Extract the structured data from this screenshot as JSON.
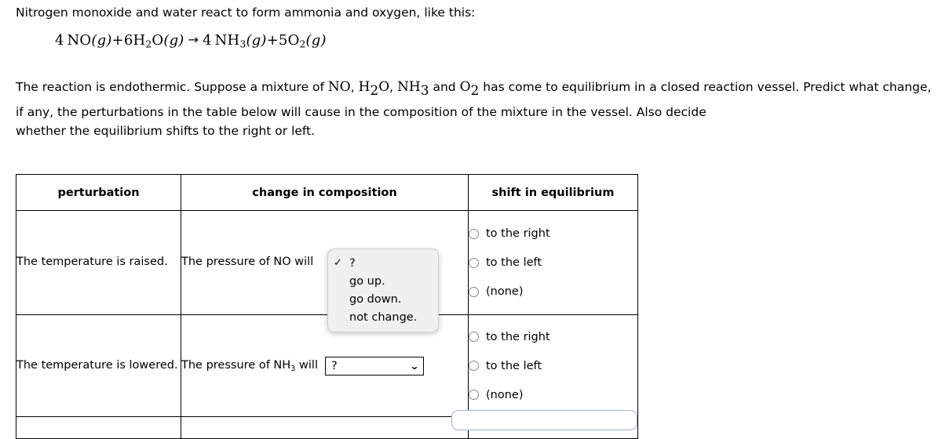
{
  "intro": {
    "sentence": "Nitrogen monoxide and water react to form ammonia and oxygen, like this:"
  },
  "equation": {
    "coeff_no": "4",
    "species_no": "NO",
    "state_no": "(g)",
    "plus1": "+",
    "coeff_h2o": "6",
    "h2o_h": "H",
    "h2o_sub": "2",
    "h2o_o": "O",
    "state_h2o": "(g)",
    "arrow": "→",
    "coeff_nh3": "4",
    "nh3_n": "NH",
    "nh3_sub": "3",
    "state_nh3": "(g)",
    "plus2": "+",
    "coeff_o2": "5",
    "o2_o": "O",
    "o2_sub": "2",
    "state_o2": "(g)"
  },
  "paragraph": {
    "part1": "The reaction is endothermic. Suppose a mixture of ",
    "chem_no": "NO",
    "comma1": ", ",
    "chem_h2o_h": "H",
    "chem_h2o_sub": "2",
    "chem_h2o_o": "O",
    "comma2": ", ",
    "chem_nh3": "NH",
    "chem_nh3_sub": "3",
    "and1": " and ",
    "chem_o2": "O",
    "chem_o2_sub": "2",
    "part2": " has come to equilibrium in a closed reaction vessel. Predict what change, if any, the perturbations in the table below will cause in the composition of the mixture in the vessel. Also decide",
    "line2": "whether the equilibrium shifts to the right or left."
  },
  "table": {
    "headers": {
      "perturbation": "perturbation",
      "change": "change in composition",
      "shift": "shift in equilibrium"
    },
    "rows": [
      {
        "perturbation": "The temperature is raised.",
        "change_label_prefix": "The pressure of ",
        "change_species": "NO",
        "change_species_sub": "",
        "change_label_suffix": " will",
        "select_value": "?",
        "chevron": "⌄",
        "shift_options": [
          "to the right",
          "to the left",
          "(none)"
        ]
      },
      {
        "perturbation": "The temperature is lowered.",
        "change_label_prefix": "The pressure of ",
        "change_species": "NH",
        "change_species_sub": "3",
        "change_label_suffix": " will",
        "select_value": "?",
        "chevron": "⌄",
        "shift_options": [
          "to the right",
          "to the left",
          "(none)"
        ]
      }
    ]
  },
  "dropdown": {
    "checkmark": "✓",
    "options": [
      {
        "label": "?",
        "checked": true
      },
      {
        "label": "go up.",
        "checked": false
      },
      {
        "label": "go down.",
        "checked": false
      },
      {
        "label": "not change.",
        "checked": false
      }
    ]
  },
  "colors": {
    "border": "#000000",
    "radio_ring": "#8a8a8a",
    "dropdown_bg": "#f0f0f0",
    "peek_border": "#9fb4c4"
  }
}
